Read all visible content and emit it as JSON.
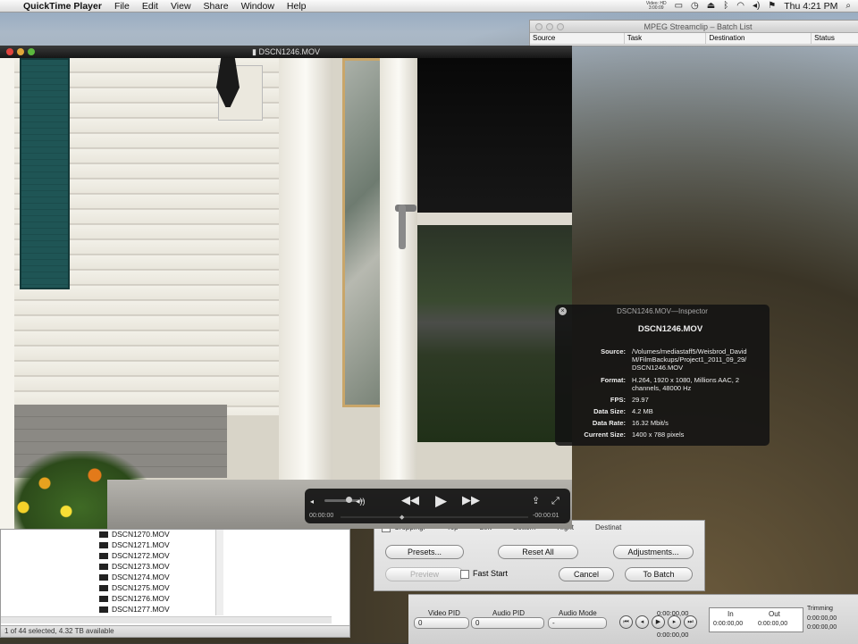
{
  "menubar": {
    "app": "QuickTime Player",
    "menus": [
      "File",
      "Edit",
      "View",
      "Share",
      "Window",
      "Help"
    ],
    "drive_top": "Video: HD",
    "drive_bottom": "3:00:09",
    "clock": "Thu 4:21 PM"
  },
  "batch_list": {
    "title": "MPEG Streamclip – Batch List",
    "columns": [
      "Source",
      "Task",
      "Destination",
      "Status"
    ]
  },
  "qt_window": {
    "title": "DSCN1246.MOV"
  },
  "inspector": {
    "header": "DSCN1246.MOV—Inspector",
    "close": "×",
    "filename": "DSCN1246.MOV",
    "rows": [
      {
        "k": "Source:",
        "v": "/Volumes/mediastaff5/Weisbrod_David M/FilmBackups/Project1_2011_09_29/ DSCN1246.MOV"
      },
      {
        "k": "Format:",
        "v": "H.264, 1920 x 1080, Millions AAC, 2 channels, 48000 Hz"
      },
      {
        "k": "FPS:",
        "v": "29.97"
      },
      {
        "k": "Data Size:",
        "v": "4.2 MB"
      },
      {
        "k": "Data Rate:",
        "v": "16.32 Mbit/s"
      },
      {
        "k": "Current Size:",
        "v": "1400 x 788 pixels"
      }
    ]
  },
  "hud": {
    "time_elapsed": "00:00:00",
    "time_remaining": "-00:00:01",
    "rewind": "◀◀",
    "play": "▶",
    "forward": "▶▶",
    "volume_low": "◂",
    "volume_high": "◂))",
    "share": "⇪",
    "fullscreen": "⤢",
    "playhead": "◆"
  },
  "export": {
    "cropping": "Cropping:",
    "crop_fields": [
      "Top",
      "Left",
      "Bottom",
      "Right",
      "Destinat"
    ],
    "presets": "Presets...",
    "reset_all": "Reset All",
    "adjustments": "Adjustments...",
    "preview": "Preview",
    "fast_start": "Fast Start",
    "cancel": "Cancel",
    "to_batch": "To Batch"
  },
  "files": {
    "items": [
      "DSCN1270.MOV",
      "DSCN1271.MOV",
      "DSCN1272.MOV",
      "DSCN1273.MOV",
      "DSCN1274.MOV",
      "DSCN1275.MOV",
      "DSCN1276.MOV",
      "DSCN1277.MOV"
    ],
    "status": "1 of 44 selected, 4.32 TB available"
  },
  "stream_panel": {
    "video_pid": "Video PID",
    "audio_pid": "Audio PID",
    "audio_mode": "Audio Mode",
    "video_val": "0",
    "audio_val": "0",
    "mode_val": "-",
    "tc_top": "0:00:00,00",
    "tc_bottom": "0:00:00,00",
    "in": "In",
    "out": "Out",
    "in_val": "0:00:00,00",
    "out_val": "0:00:00,00",
    "trimming": "Trimming",
    "trim_val1": "0:00:00,00",
    "trim_val2": "0:00:00,00"
  }
}
